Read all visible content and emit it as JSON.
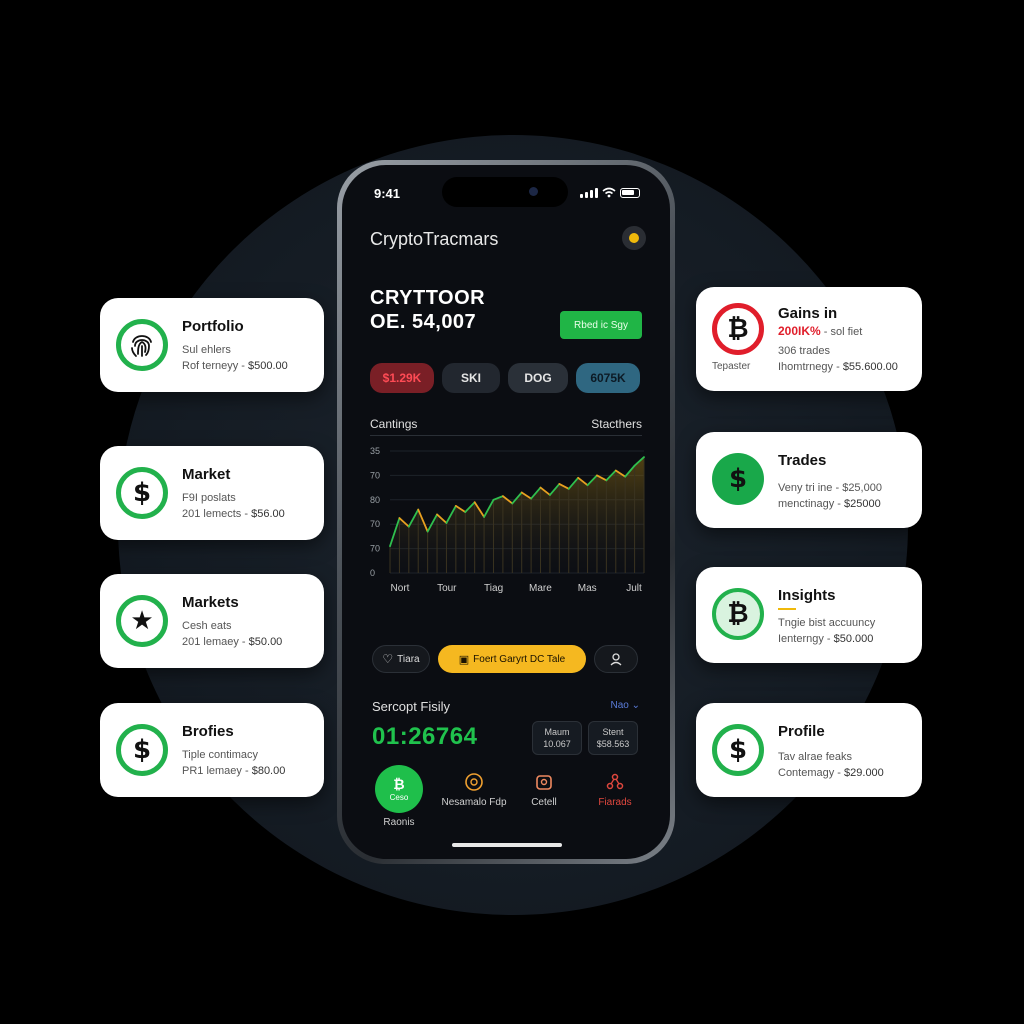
{
  "colors": {
    "accent_green": "#20b546",
    "accent_red": "#e01e2b",
    "accent_yellow": "#f5b820",
    "screen_bg": "#0b0d12"
  },
  "status_bar": {
    "time": "9:41"
  },
  "app": {
    "title": "CryptoTracmars",
    "settings_icon": "settings-icon"
  },
  "balance": {
    "label": "CRYTTOOR",
    "value": "OE. 54,007",
    "action_label": "Rbed ic Sgy"
  },
  "chips": [
    "$1.29K",
    "SKI",
    "DOG",
    "6075K"
  ],
  "chart": {
    "left_heading": "Cantings",
    "right_heading": "Stacthers"
  },
  "chart_data": {
    "type": "area",
    "title": "",
    "y_ticks": [
      "35",
      "70",
      "80",
      "70",
      "70",
      "0"
    ],
    "x_ticks": [
      "Nort",
      "Tour",
      "Tiag",
      "Mare",
      "Mas",
      "Jult"
    ],
    "series": [
      {
        "values": [
          22,
          45,
          38,
          52,
          34,
          48,
          41,
          55,
          50,
          58,
          46,
          60,
          63,
          57,
          66,
          61,
          70,
          64,
          73,
          69,
          78,
          72,
          80,
          76,
          84,
          79,
          88,
          95
        ]
      }
    ],
    "ylim": [
      0,
      100
    ]
  },
  "actions": {
    "watch_label": "Tiara",
    "primary_label": "Foert Garyrt DC Tale",
    "profile_icon": "user-icon"
  },
  "section": {
    "title": "Sercopt Fisily",
    "more": "Nao ⌄",
    "big_value": "01:26764"
  },
  "mini_stats": [
    {
      "label": "Maum",
      "value": "10.067"
    },
    {
      "label": "Stent",
      "value": "$58.563"
    }
  ],
  "tabs": [
    {
      "label": "Raonis",
      "icon": "bitcoin-icon",
      "inner": "Ceso"
    },
    {
      "label": "Nesamalo Fdp",
      "icon": "clock-icon"
    },
    {
      "label": "Cetell",
      "icon": "wallet-icon"
    },
    {
      "label": "Fiarads",
      "icon": "network-icon"
    }
  ],
  "left_cards": [
    {
      "title": "Portfolio",
      "line1": "Sul ehlers",
      "line2": "Rof terneyy - ",
      "amount": "$500.00",
      "icon": "fingerprint-icon"
    },
    {
      "title": "Market",
      "line1": "F9I poslats",
      "line2": "201 lemects - ",
      "amount": "$56.00",
      "icon": "dollar-icon"
    },
    {
      "title": "Markets",
      "line1": "Cesh eats",
      "line2": "201 lemaey - ",
      "amount": "$50.00",
      "icon": "star-icon"
    },
    {
      "title": "Brofies",
      "line1": "Tiple contimacy",
      "line2": "PR1 lemaey - ",
      "amount": "$80.00",
      "icon": "dollar-icon"
    }
  ],
  "right_cards": [
    {
      "title": "Gains in",
      "highlight": "200IK%",
      "highlight_rest": " - sol fiet",
      "line1": "306 trades",
      "line2": "Ihomtrnegy - ",
      "amount": "$55.600.00",
      "side": "Tepaster",
      "icon": "bitcoin-icon"
    },
    {
      "title": "Trades",
      "line1": "Veny tri ine - $25,000",
      "line2": "menctinagy - ",
      "amount": "$25000",
      "icon": "dollar-icon"
    },
    {
      "title": "Insights",
      "line1": "Tngie bist accuuncy",
      "line2": "Ienterngy - ",
      "amount": "$50.000",
      "icon": "bitcoin-icon"
    },
    {
      "title": "Profile",
      "line1": "Tav alrae feaks",
      "line2": "Contemagy - ",
      "amount": "$29.000",
      "icon": "dollar-icon"
    }
  ]
}
